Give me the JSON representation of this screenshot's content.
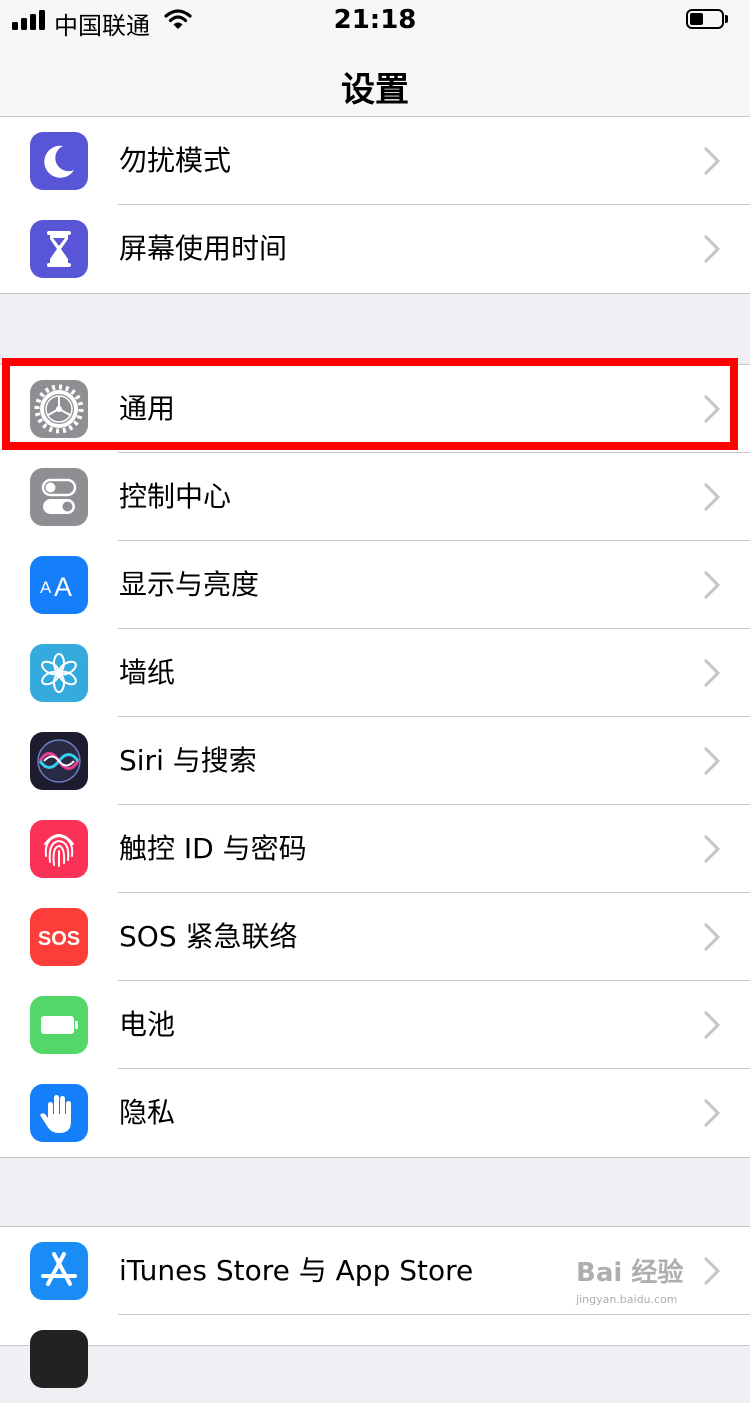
{
  "status_bar": {
    "carrier": "中国联通",
    "time": "21:18"
  },
  "nav": {
    "title": "设置"
  },
  "groups": [
    {
      "items": [
        {
          "label": "勿扰模式",
          "icon": "moon-icon",
          "color": "#5856d6"
        },
        {
          "label": "屏幕使用时间",
          "icon": "hourglass-icon",
          "color": "#5856d6"
        }
      ]
    },
    {
      "items": [
        {
          "label": "通用",
          "icon": "gear-icon",
          "color": "#8e8e93",
          "highlighted": true
        },
        {
          "label": "控制中心",
          "icon": "toggles-icon",
          "color": "#8e8e93"
        },
        {
          "label": "显示与亮度",
          "icon": "text-size-icon",
          "color": "#147efb"
        },
        {
          "label": "墙纸",
          "icon": "flower-icon",
          "color": "#35aadc"
        },
        {
          "label": "Siri 与搜索",
          "icon": "siri-icon",
          "color": "#1c1c2e"
        },
        {
          "label": "触控 ID 与密码",
          "icon": "fingerprint-icon",
          "color": "#fc3158"
        },
        {
          "label": "SOS 紧急联络",
          "icon": "sos-icon",
          "color": "#fc3d39",
          "icon_text": "SOS"
        },
        {
          "label": "电池",
          "icon": "battery-icon",
          "color": "#53d769"
        },
        {
          "label": "隐私",
          "icon": "hand-icon",
          "color": "#147efb"
        }
      ]
    },
    {
      "items": [
        {
          "label": "iTunes Store 与 App Store",
          "icon": "app-store-icon",
          "color": "#1a8cf6"
        }
      ]
    }
  ],
  "watermark": {
    "brand": "Bai 经验",
    "url": "jingyan.baidu.com"
  }
}
